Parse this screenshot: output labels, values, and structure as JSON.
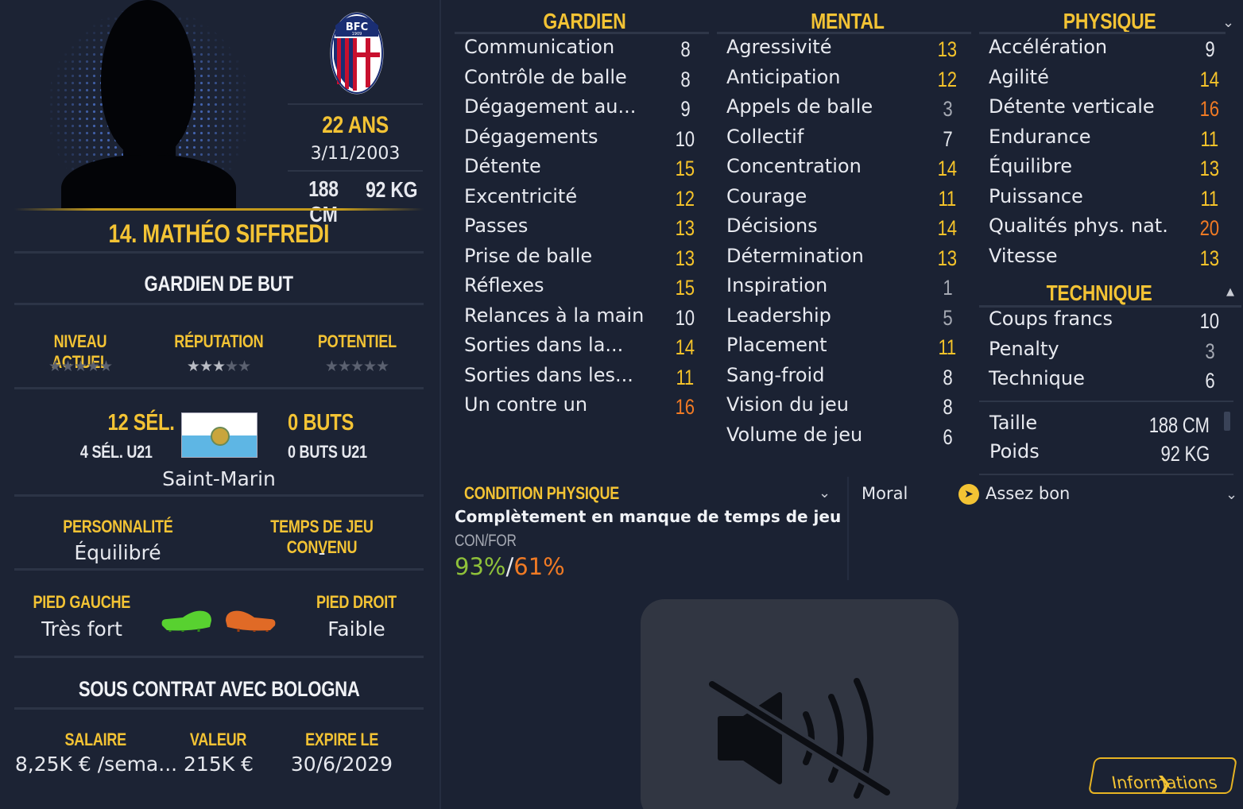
{
  "player": {
    "number_name": "14. MATHÉO SIFFREDI",
    "age": "22 ANS",
    "dob": "3/11/2003",
    "height": "188 CM",
    "weight": "92 KG",
    "position": "GARDIEN DE BUT",
    "club_crest": "BFC 1909"
  },
  "ratings": {
    "current_label": "NIVEAU ACTUEL",
    "current_stars": "★★★★★",
    "reputation_label": "RÉPUTATION",
    "reputation_stars_on": "★★★",
    "reputation_stars_off": "★★",
    "reputation_value": 3.5,
    "potential_label": "POTENTIEL",
    "potential_stars": "★★★★★"
  },
  "intl": {
    "caps": "12 SÉL.",
    "caps_u21": "4 SÉL. U21",
    "goals": "0 BUTS",
    "goals_u21": "0 BUTS U21",
    "country": "Saint-Marin"
  },
  "personality": {
    "personality_label": "PERSONNALITÉ",
    "personality_value": "Équilibré",
    "playing_time_label": "TEMPS DE JEU CONVENU",
    "playing_time_value": "-"
  },
  "feet": {
    "left_label": "PIED GAUCHE",
    "left_value": "Très fort",
    "right_label": "PIED DROIT",
    "right_value": "Faible"
  },
  "contract": {
    "title": "SOUS CONTRAT AVEC BOLOGNA",
    "wage_label": "SALAIRE",
    "wage_value": "8,25K € /sema...",
    "value_label": "VALEUR",
    "value_value": "215K €",
    "expires_label": "EXPIRE LE",
    "expires_value": "30/6/2029"
  },
  "attributes": {
    "gardien_title": "GARDIEN",
    "mental_title": "MENTAL",
    "physique_title": "PHYSIQUE",
    "technique_title": "TECHNIQUE",
    "gardien": [
      {
        "name": "Communication",
        "value": "8",
        "tier": "white"
      },
      {
        "name": "Contrôle de balle",
        "value": "8",
        "tier": "white"
      },
      {
        "name": "Dégagement au...",
        "value": "9",
        "tier": "white"
      },
      {
        "name": "Dégagements",
        "value": "10",
        "tier": "white"
      },
      {
        "name": "Détente",
        "value": "15",
        "tier": "yellow"
      },
      {
        "name": "Excentricité",
        "value": "12",
        "tier": "yellow"
      },
      {
        "name": "Passes",
        "value": "13",
        "tier": "yellow"
      },
      {
        "name": "Prise de balle",
        "value": "13",
        "tier": "yellow"
      },
      {
        "name": "Réflexes",
        "value": "15",
        "tier": "yellow"
      },
      {
        "name": "Relances à la main",
        "value": "10",
        "tier": "white"
      },
      {
        "name": "Sorties dans la...",
        "value": "14",
        "tier": "yellow"
      },
      {
        "name": "Sorties dans les...",
        "value": "11",
        "tier": "yellow"
      },
      {
        "name": "Un contre un",
        "value": "16",
        "tier": "orange"
      }
    ],
    "mental": [
      {
        "name": "Agressivité",
        "value": "13",
        "tier": "yellow"
      },
      {
        "name": "Anticipation",
        "value": "12",
        "tier": "yellow"
      },
      {
        "name": "Appels de balle",
        "value": "3",
        "tier": "gray"
      },
      {
        "name": "Collectif",
        "value": "7",
        "tier": "white"
      },
      {
        "name": "Concentration",
        "value": "14",
        "tier": "yellow"
      },
      {
        "name": "Courage",
        "value": "11",
        "tier": "yellow"
      },
      {
        "name": "Décisions",
        "value": "14",
        "tier": "yellow"
      },
      {
        "name": "Détermination",
        "value": "13",
        "tier": "yellow"
      },
      {
        "name": "Inspiration",
        "value": "1",
        "tier": "gray"
      },
      {
        "name": "Leadership",
        "value": "5",
        "tier": "gray"
      },
      {
        "name": "Placement",
        "value": "11",
        "tier": "yellow"
      },
      {
        "name": "Sang-froid",
        "value": "8",
        "tier": "white"
      },
      {
        "name": "Vision du jeu",
        "value": "8",
        "tier": "white"
      },
      {
        "name": "Volume de jeu",
        "value": "6",
        "tier": "white"
      }
    ],
    "physique": [
      {
        "name": "Accélération",
        "value": "9",
        "tier": "white"
      },
      {
        "name": "Agilité",
        "value": "14",
        "tier": "yellow"
      },
      {
        "name": "Détente verticale",
        "value": "16",
        "tier": "orange"
      },
      {
        "name": "Endurance",
        "value": "11",
        "tier": "yellow"
      },
      {
        "name": "Équilibre",
        "value": "13",
        "tier": "yellow"
      },
      {
        "name": "Puissance",
        "value": "11",
        "tier": "yellow"
      },
      {
        "name": "Qualités phys. nat.",
        "value": "20",
        "tier": "orange"
      },
      {
        "name": "Vitesse",
        "value": "13",
        "tier": "yellow"
      }
    ],
    "technique": [
      {
        "name": "Coups francs",
        "value": "10",
        "tier": "white"
      },
      {
        "name": "Penalty",
        "value": "3",
        "tier": "gray"
      },
      {
        "name": "Technique",
        "value": "6",
        "tier": "white"
      }
    ],
    "size": {
      "height_label": "Taille",
      "height_value": "188 CM",
      "weight_label": "Poids",
      "weight_value": "92 KG"
    }
  },
  "condition": {
    "title": "CONDITION PHYSIQUE",
    "status": "Complètement en manque de temps de jeu",
    "label": "CON/FOR",
    "con": "93%",
    "sep": "/",
    "for": "61%",
    "morale_label": "Moral",
    "morale_value": "Assez bon"
  },
  "buttons": {
    "info": "Informations"
  },
  "colors": {
    "accent": "#f3c334",
    "orange": "#f07a24",
    "green": "#8fc13a",
    "background": "#1b2233"
  },
  "icons": [
    "bologna-crest-icon",
    "san-marino-flag-icon",
    "left-boot-icon",
    "right-boot-icon",
    "mute-icon",
    "chevron-right-icon",
    "chevron-down-icon",
    "chevron-up-icon",
    "morale-icon"
  ]
}
